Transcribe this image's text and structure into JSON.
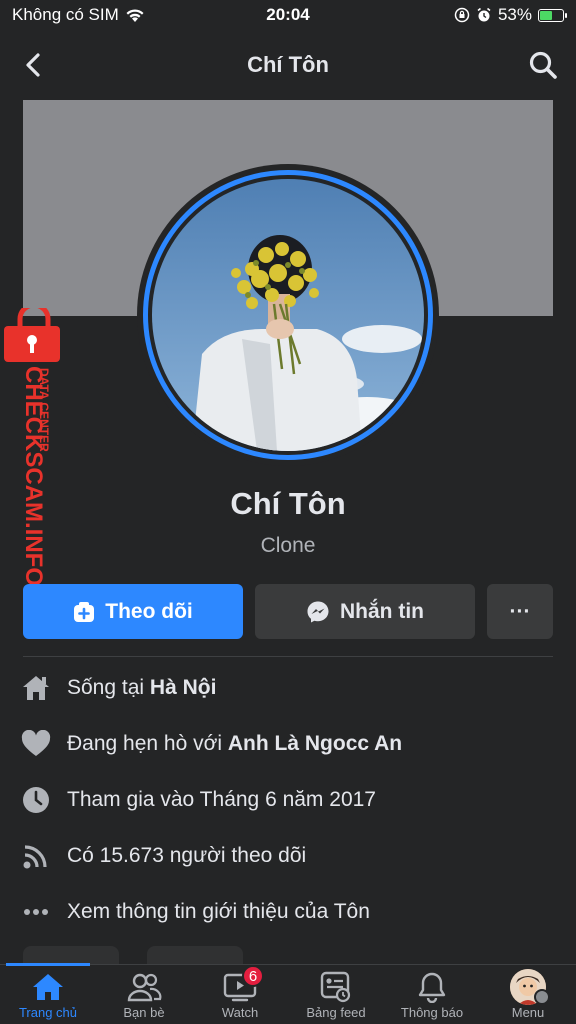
{
  "status_bar": {
    "carrier": "Không có SIM",
    "time": "20:04",
    "battery": "53%",
    "battery_level": 0.53
  },
  "header": {
    "title": "Chí Tôn"
  },
  "profile": {
    "name": "Chí Tôn",
    "subtitle": "Clone"
  },
  "watermark": {
    "main_text": "CHECKSCAM.INFO",
    "small_text": "DATA CENTER"
  },
  "actions": {
    "follow_label": "Theo dõi",
    "message_label": "Nhắn tin",
    "more_label": "···"
  },
  "intro": [
    {
      "icon": "home-icon",
      "prefix": "Sống tại ",
      "bold": "Hà Nội"
    },
    {
      "icon": "heart-icon",
      "prefix": "Đang hẹn hò với ",
      "bold": "Anh Là Ngocc An"
    },
    {
      "icon": "clock-icon",
      "prefix": "Tham gia vào Tháng 6 năm 2017",
      "bold": ""
    },
    {
      "icon": "rss-icon",
      "prefix": "Có 15.673 người theo dõi",
      "bold": ""
    },
    {
      "icon": "ellipsis-icon",
      "prefix": "Xem thông tin giới thiệu của Tôn",
      "bold": ""
    }
  ],
  "tabs": [
    {
      "label": "Trang chủ",
      "icon": "home-icon",
      "active": true
    },
    {
      "label": "Bạn bè",
      "icon": "friends-icon"
    },
    {
      "label": "Watch",
      "icon": "watch-icon",
      "badge": "6"
    },
    {
      "label": "Bảng feed",
      "icon": "feed-icon"
    },
    {
      "label": "Thông báo",
      "icon": "bell-icon"
    },
    {
      "label": "Menu",
      "icon": "menu-avatar-icon"
    }
  ],
  "colors": {
    "accent": "#2d88ff",
    "background": "#242526",
    "badge": "#e41e3f",
    "watermark": "#e8322b"
  }
}
